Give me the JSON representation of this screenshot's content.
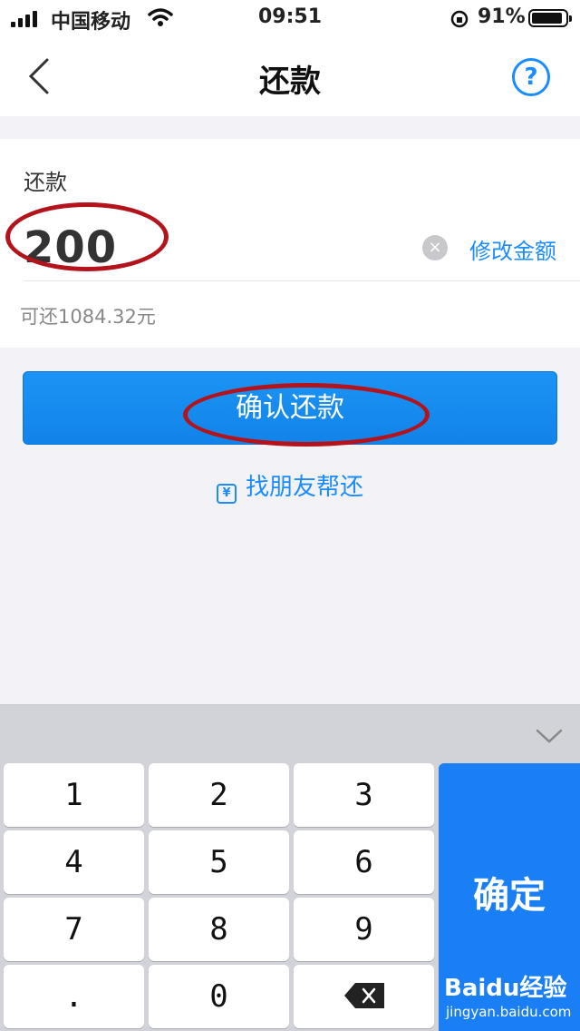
{
  "status_bar": {
    "carrier": "中国移动",
    "time": "09:51",
    "battery": "91%",
    "battery_level": 0.91
  },
  "navbar": {
    "title": "还款",
    "help_icon": "?"
  },
  "repay_card": {
    "label": "还款",
    "amount": "200",
    "clear_icon": "×",
    "modify_link": "修改金额",
    "available": "可还1084.32元"
  },
  "actions": {
    "confirm_button": "确认还款",
    "friend_icon": "¥",
    "friend_link": "找朋友帮还"
  },
  "keypad": {
    "keys": [
      "1",
      "2",
      "3",
      "4",
      "5",
      "6",
      "7",
      "8",
      "9",
      ".",
      "0"
    ],
    "confirm": "确定"
  },
  "watermark": {
    "brand": "Baidu经验",
    "url": "jingyan.baidu.com"
  },
  "colors": {
    "accent": "#1a8cff",
    "confirm_key": "#1a7ef5",
    "annotation": "#b5131c"
  }
}
